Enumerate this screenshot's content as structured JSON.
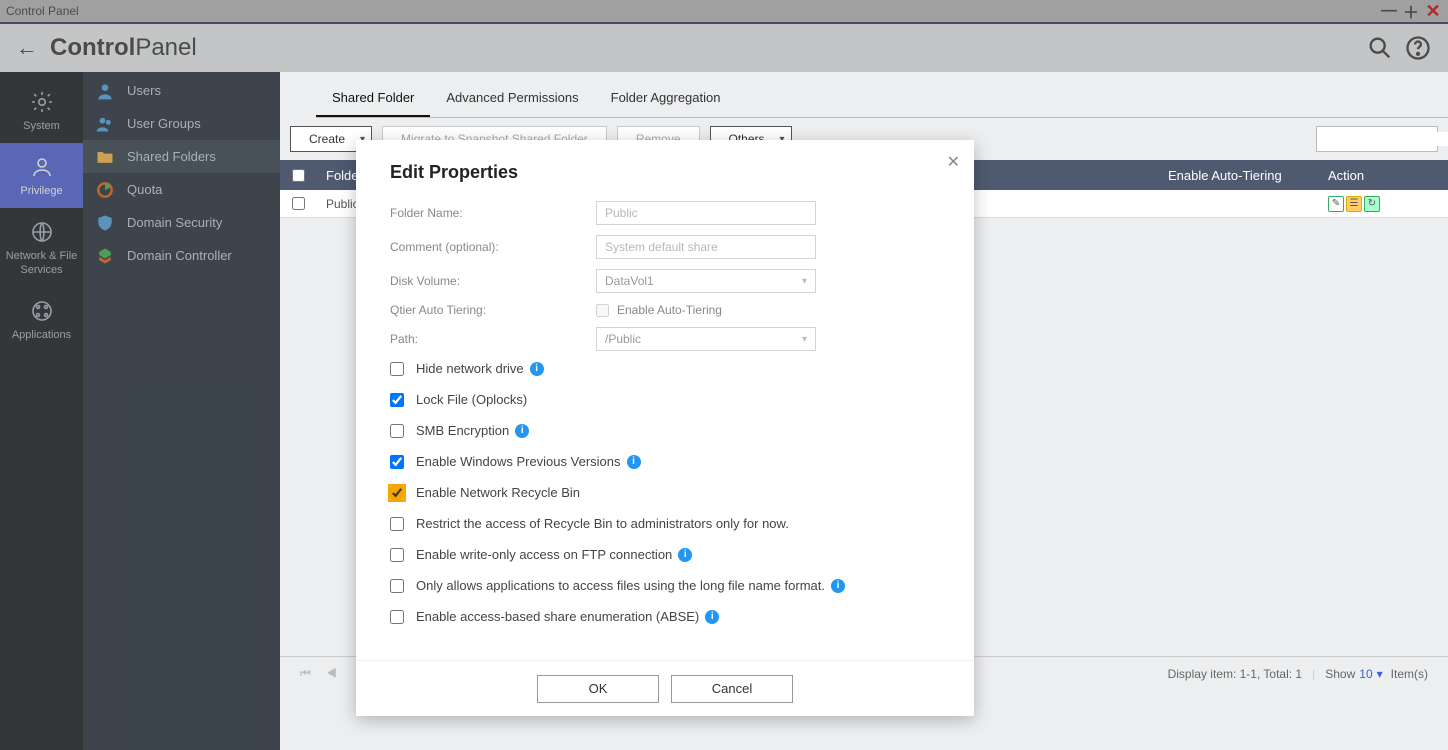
{
  "titlebar": {
    "text": "Control Panel"
  },
  "header": {
    "title_bold": "Control",
    "title_light": "Panel"
  },
  "icon_sidebar": {
    "items": [
      {
        "label": "System"
      },
      {
        "label": "Privilege"
      },
      {
        "label": "Network & File Services"
      },
      {
        "label": "Applications"
      }
    ]
  },
  "sidebar": {
    "items": [
      {
        "label": "Users"
      },
      {
        "label": "User Groups"
      },
      {
        "label": "Shared Folders"
      },
      {
        "label": "Quota"
      },
      {
        "label": "Domain Security"
      },
      {
        "label": "Domain Controller"
      }
    ]
  },
  "tabs": {
    "items": [
      {
        "label": "Shared Folder"
      },
      {
        "label": "Advanced Permissions"
      },
      {
        "label": "Folder Aggregation"
      }
    ]
  },
  "toolbar": {
    "create": "Create",
    "migrate": "Migrate to Snapshot Shared Folder",
    "remove": "Remove",
    "others": "Others"
  },
  "table": {
    "head": {
      "name": "Folder Name",
      "tier": "Enable Auto-Tiering",
      "action": "Action"
    },
    "rows": [
      {
        "name": "Public"
      }
    ]
  },
  "footer": {
    "display": "Display item: 1-1, Total: 1",
    "show_label": "Show",
    "show_value": "10",
    "items_label": "Item(s)"
  },
  "modal": {
    "title": "Edit Properties",
    "labels": {
      "folder_name": "Folder Name:",
      "comment": "Comment (optional):",
      "disk_volume": "Disk Volume:",
      "qtier": "Qtier Auto Tiering:",
      "enable_tiering": "Enable Auto-Tiering",
      "path": "Path:"
    },
    "values": {
      "folder_name": "Public",
      "comment": "System default share",
      "disk_volume": "DataVol1",
      "path": "/Public"
    },
    "checkboxes": {
      "hide_net": "Hide network drive",
      "lock_file": "Lock File (Oplocks)",
      "smb_enc": "SMB Encryption",
      "win_prev": "Enable Windows Previous Versions",
      "recycle": "Enable Network Recycle Bin",
      "restrict": "Restrict the access of Recycle Bin to administrators only for now.",
      "ftp_write": "Enable write-only access on FTP connection",
      "long_name": "Only allows applications to access files using the long file name format.",
      "abse": "Enable access-based share enumeration (ABSE)"
    },
    "buttons": {
      "ok": "OK",
      "cancel": "Cancel"
    }
  }
}
